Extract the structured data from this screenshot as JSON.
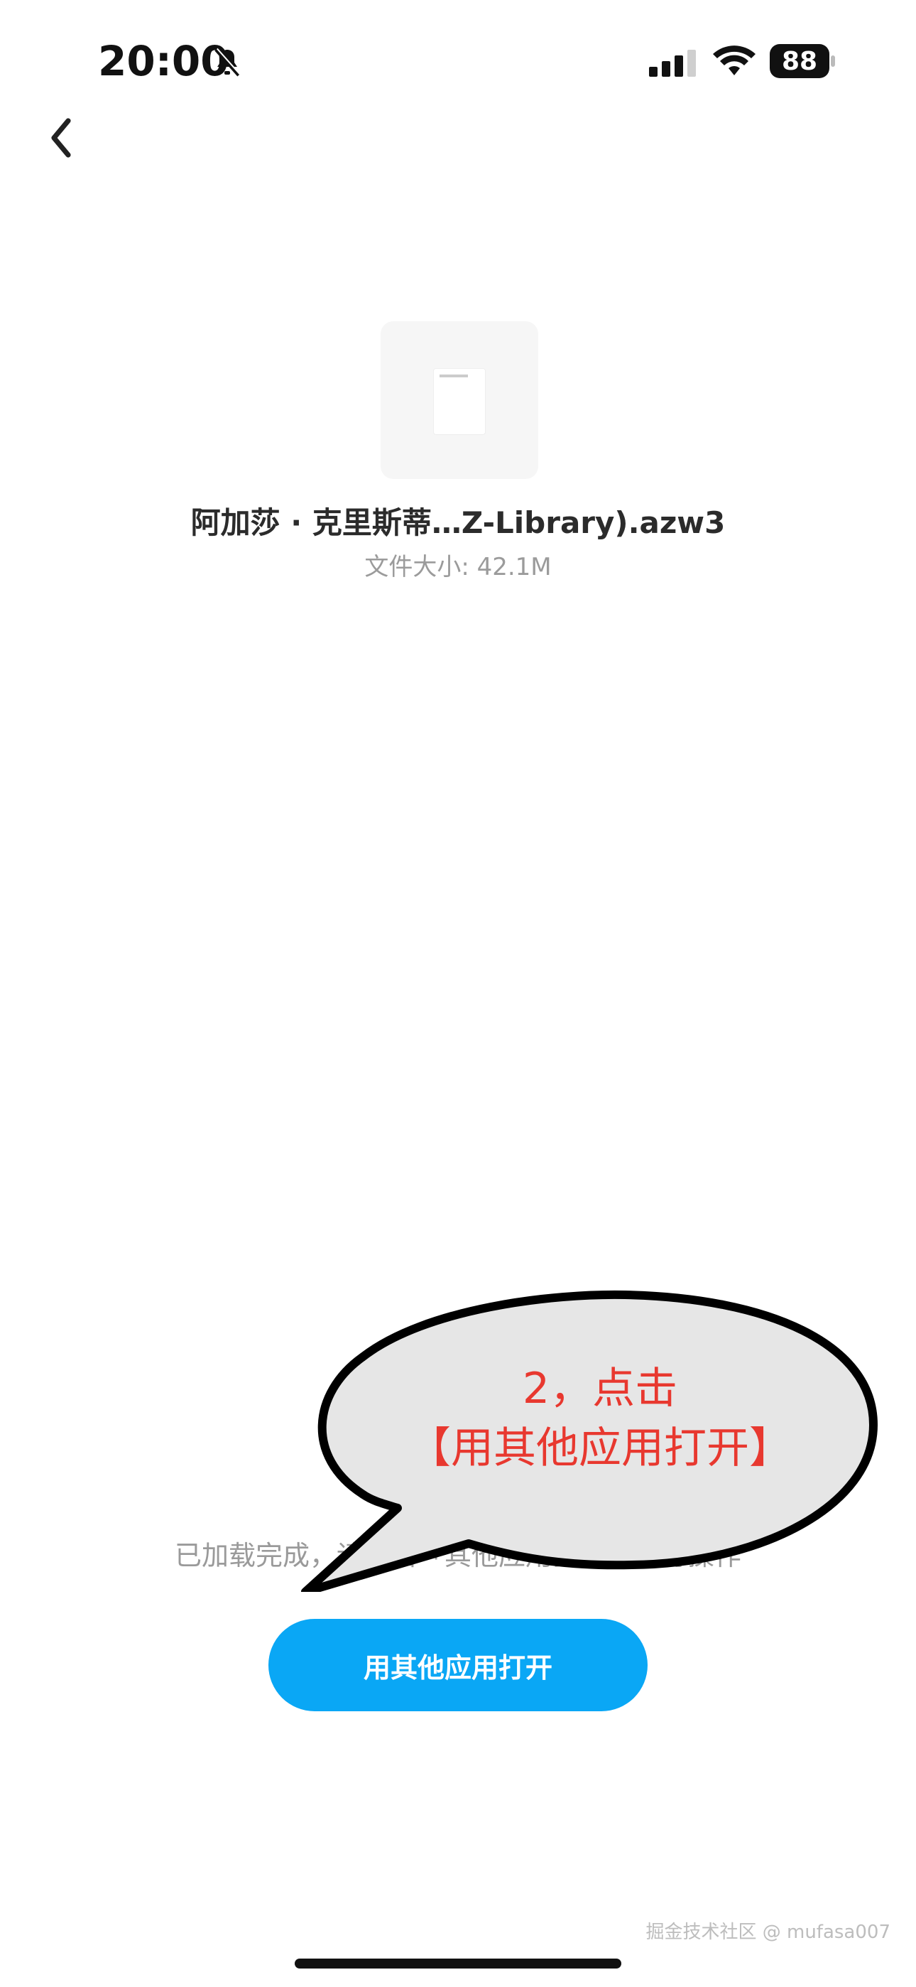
{
  "status_bar": {
    "time": "20:00",
    "battery_level": "88",
    "icons": [
      "bell-slash-icon",
      "signal-icon",
      "wifi-icon",
      "battery-icon"
    ]
  },
  "header": {
    "back_icon": "chevron-left-icon"
  },
  "file": {
    "name": "阿加莎 · 克里斯蒂…Z-Library).azw3",
    "size_text": "文件大小: 42.1M"
  },
  "hint": {
    "text": "已加载完成，请点击「其他应用打开」进行操作"
  },
  "primary_action": {
    "label": "用其他应用打开"
  },
  "annotation": {
    "line1": "2，点击",
    "line2": "【用其他应用打开】",
    "text_color": "#e8382f",
    "bubble_fill": "#e6e6e6"
  },
  "watermark": {
    "text": "掘金技术社区 @ mufasa007"
  },
  "colors": {
    "primary": "#0aa7f5",
    "hint": "#9a9a9a"
  }
}
